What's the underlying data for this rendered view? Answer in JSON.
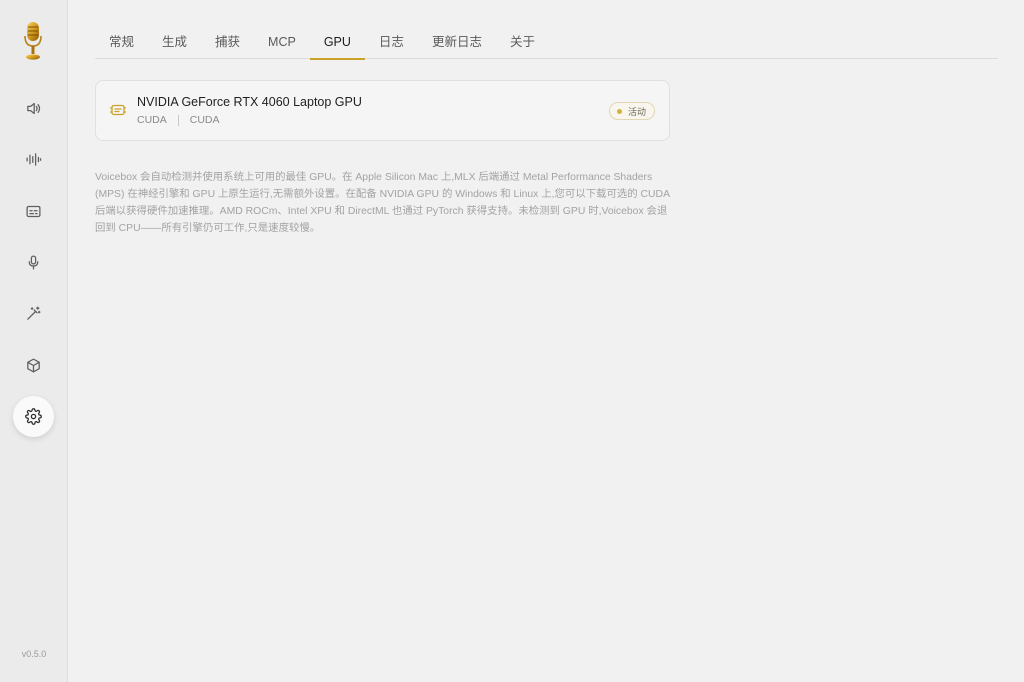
{
  "sidebar": {
    "logo_icon": "golden-microphone-icon",
    "items": [
      {
        "id": "voices",
        "icon": "speaker-icon"
      },
      {
        "id": "audio",
        "icon": "waveform-icon"
      },
      {
        "id": "captions",
        "icon": "captions-icon"
      },
      {
        "id": "record",
        "icon": "microphone-icon"
      },
      {
        "id": "effects",
        "icon": "magic-wand-icon"
      },
      {
        "id": "models",
        "icon": "cube-icon"
      },
      {
        "id": "settings",
        "icon": "gear-icon",
        "active": true
      }
    ],
    "version": "v0.5.0"
  },
  "tabs": [
    {
      "label": "常规"
    },
    {
      "label": "生成"
    },
    {
      "label": "捕获"
    },
    {
      "label": "MCP"
    },
    {
      "label": "GPU",
      "active": true
    },
    {
      "label": "日志"
    },
    {
      "label": "更新日志"
    },
    {
      "label": "关于"
    }
  ],
  "gpu": {
    "name": "NVIDIA GeForce RTX 4060 Laptop GPU",
    "backend": "CUDA",
    "type": "CUDA",
    "status": "活动",
    "icon": "gpu-chip-icon",
    "accent_color": "#c9a227"
  },
  "description": "Voicebox 会自动检测并使用系统上可用的最佳 GPU。在 Apple Silicon Mac 上,MLX 后端通过 Metal Performance Shaders (MPS) 在神经引擎和 GPU 上原生运行,无需额外设置。在配备 NVIDIA GPU 的 Windows 和 Linux 上,您可以下载可选的 CUDA 后端以获得硬件加速推理。AMD ROCm、Intel XPU 和 DirectML 也通过 PyTorch 获得支持。未检测到 GPU 时,Voicebox 会退回到 CPU——所有引擎仍可工作,只是速度较慢。"
}
